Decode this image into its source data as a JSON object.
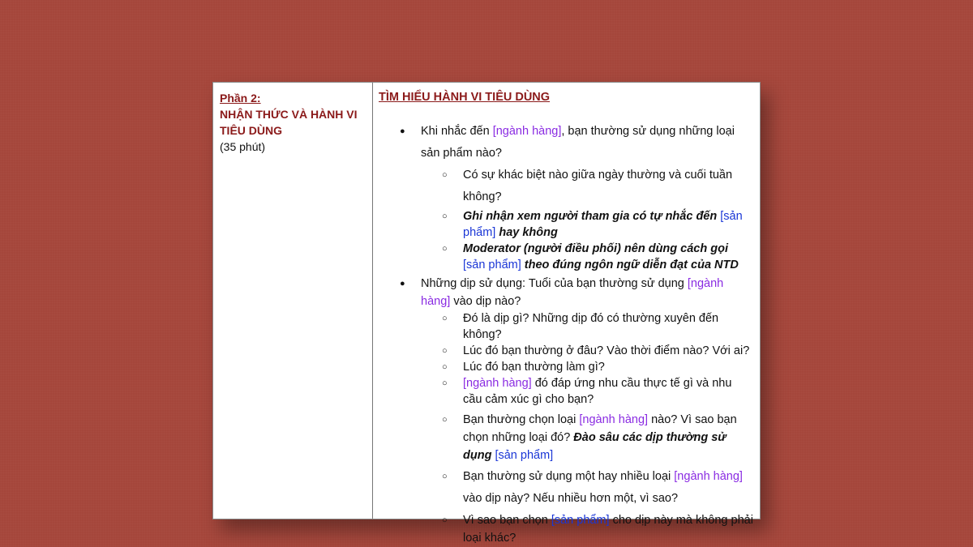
{
  "left": {
    "part": "Phần 2:",
    "heading_line1": "NHẬN THỨC VÀ HÀNH VI",
    "heading_line2": "TIÊU DÙNG",
    "duration": "(35 phút)"
  },
  "right": {
    "title": "TÌM HIỂU HÀNH VI TIÊU DÙNG",
    "q1": {
      "a": "Khi nhắc đến ",
      "tag": "[ngành hàng]",
      "b": ", bạn thường sử dụng những loại sản phẩm nào?",
      "subs": {
        "s1": "Có sự khác biệt nào giữa ngày thường và cuối tuần không?",
        "s2a": "Ghi nhận xem người tham gia có tự nhắc đến ",
        "s2tag": "[sản phẩm]",
        "s2b": " hay không",
        "s3a": "Moderator (người điều phối) nên dùng cách gọi ",
        "s3tag": "[sản phẩm]",
        "s3b": " theo đúng ngôn ngữ diễn đạt của NTD"
      }
    },
    "q2": {
      "a": "Những dịp sử dụng: Tuổi của bạn thường sử dụng ",
      "tag": "[ngành hàng]",
      "b": " vào dịp nào?",
      "subs": {
        "s1": "Đó là dịp gì? Những dịp đó có thường xuyên đến không?",
        "s2": "Lúc đó bạn thường ở đâu? Vào thời điểm nào? Với ai?",
        "s3": "Lúc đó bạn thường làm gì?",
        "s4tag": "[ngành hàng]",
        "s4b": " đó đáp ứng nhu cầu thực tế gì và nhu cầu cảm xúc gì cho bạn?",
        "s5a": "Bạn thường chọn loại ",
        "s5tag": "[ngành hàng]",
        "s5b": " nào? Vì sao bạn chọn những loại đó? ",
        "s5note": "Đào sâu các dịp thường sử dụng",
        "s5tag2": "[sản phẩm]",
        "s6a": "Bạn thường sử dụng một hay nhiều loại ",
        "s6tag": "[ngành hàng]",
        "s6b": " vào dịp này? Nếu nhiều hơn một, vì sao?",
        "s7a": "Vì sao bạn chọn ",
        "s7tag": "[sản phẩm]",
        "s7b": " cho dịp này mà không phải loại khác?"
      }
    },
    "bullet_filled": "●",
    "bullet_hollow": "○"
  }
}
